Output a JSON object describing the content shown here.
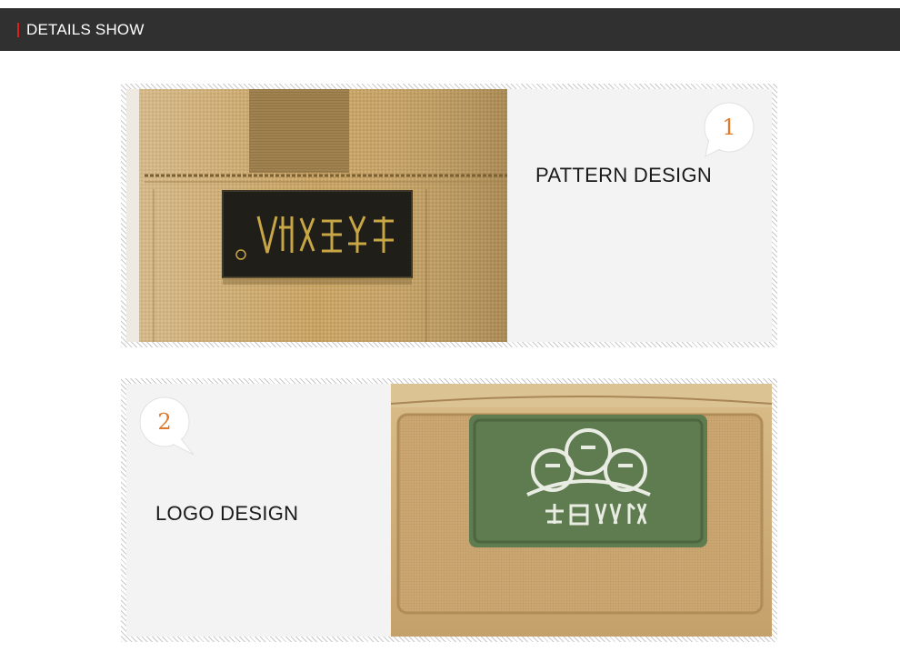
{
  "header": {
    "title": "DETAILS SHOW",
    "accent_color": "#d8201c",
    "bar_color": "#303030"
  },
  "details": [
    {
      "number": "1",
      "label": "PATTERN DESIGN",
      "image": "woven-label-closeup"
    },
    {
      "number": "2",
      "label": "LOGO DESIGN",
      "image": "rubber-patch-closeup"
    }
  ],
  "colors": {
    "number_orange": "#e07a2a",
    "panel_bg": "#f3f3f3",
    "fabric_tan": "#c9a56a"
  }
}
